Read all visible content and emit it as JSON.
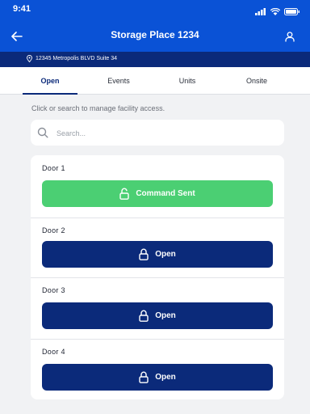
{
  "status_bar": {
    "time": "9:41"
  },
  "header": {
    "title": "Storage Place 1234"
  },
  "address": {
    "text": "12345 Metropolis BLVD Suite 34"
  },
  "tabs": [
    {
      "label": "Open",
      "active": true
    },
    {
      "label": "Events",
      "active": false
    },
    {
      "label": "Units",
      "active": false
    },
    {
      "label": "Onsite",
      "active": false
    }
  ],
  "hint": "Click or search to manage facility access.",
  "search": {
    "placeholder": "Search...",
    "value": ""
  },
  "doors": [
    {
      "label": "Door 1",
      "button": "Command Sent",
      "state": "sent"
    },
    {
      "label": "Door 2",
      "button": "Open",
      "state": "open"
    },
    {
      "label": "Door 3",
      "button": "Open",
      "state": "open"
    },
    {
      "label": "Door 4",
      "button": "Open",
      "state": "open"
    }
  ],
  "colors": {
    "primary_blue": "#0a52d6",
    "navy": "#0b2a7a",
    "success_green": "#4bcf73",
    "background": "#f1f2f4"
  }
}
